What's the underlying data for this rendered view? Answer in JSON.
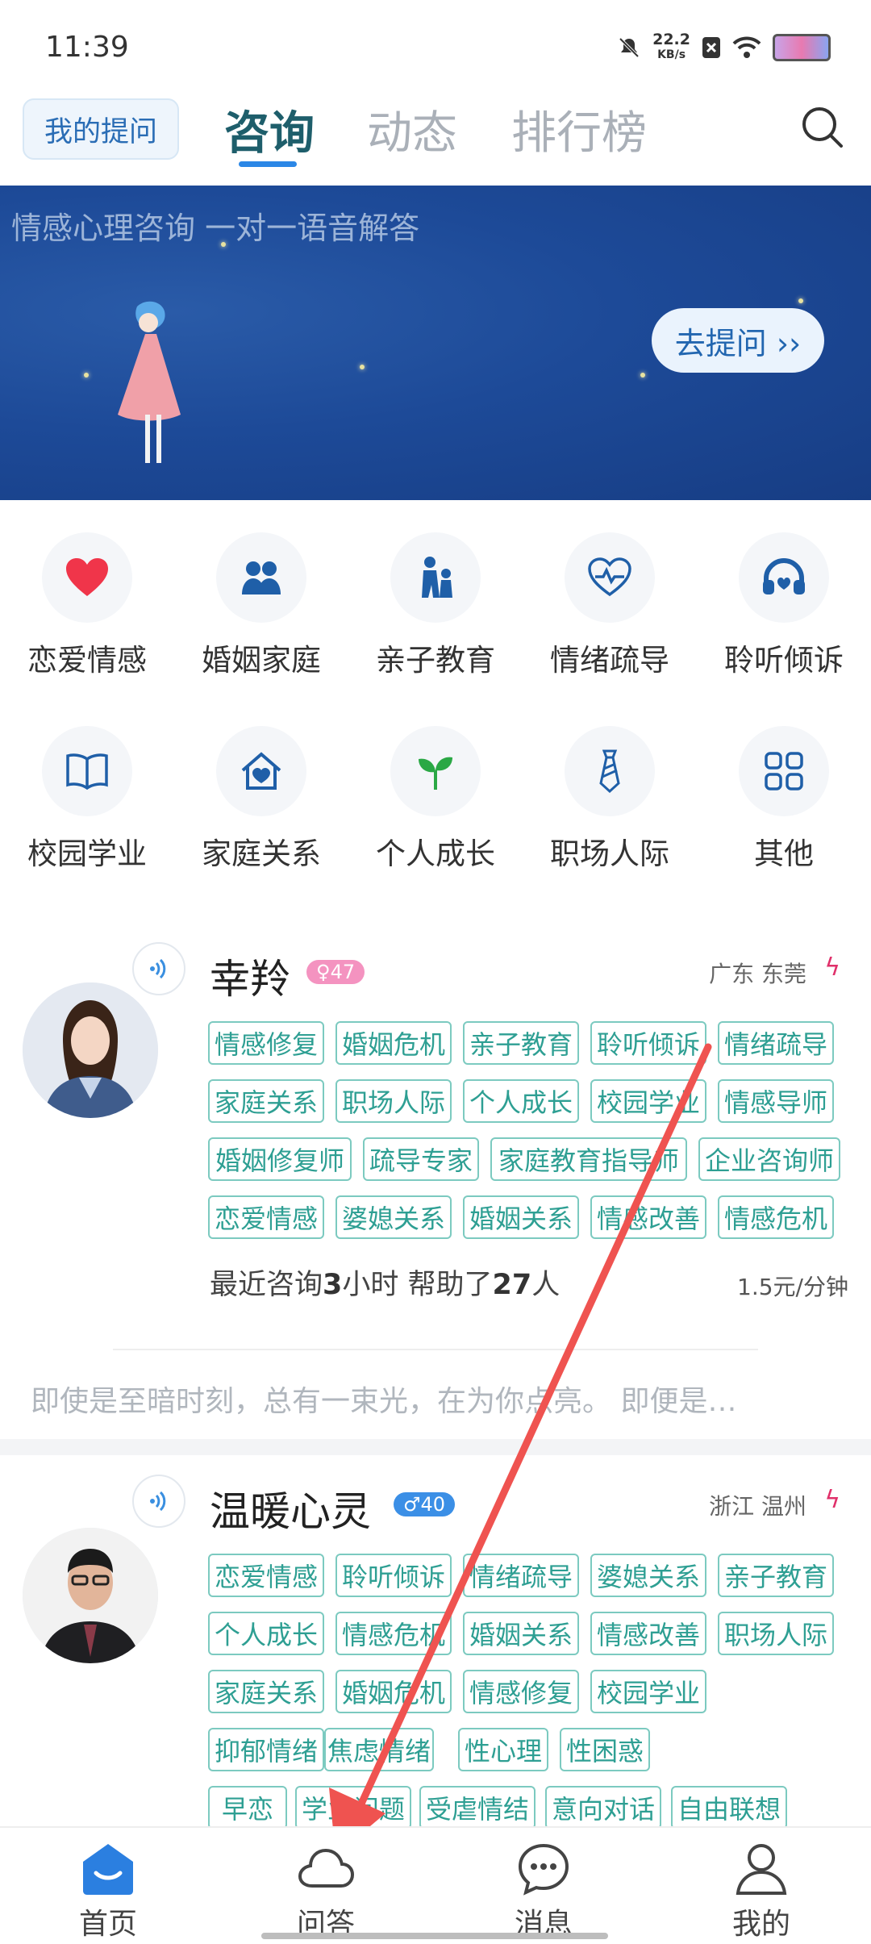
{
  "status_bar": {
    "time": "11:39",
    "net_speed_value": "22.2",
    "net_speed_unit": "KB/s"
  },
  "header": {
    "my_questions": "我的提问",
    "tabs": [
      {
        "label": "咨询",
        "active": true
      },
      {
        "label": "动态",
        "active": false
      },
      {
        "label": "排行榜",
        "active": false
      }
    ]
  },
  "banner": {
    "title": "情感心理咨询 一对一语音解答",
    "button": "去提问 ››"
  },
  "categories": [
    {
      "label": "恋爱情感",
      "icon": "heart-icon"
    },
    {
      "label": "婚姻家庭",
      "icon": "couple-icon"
    },
    {
      "label": "亲子教育",
      "icon": "parent-child-icon"
    },
    {
      "label": "情绪疏导",
      "icon": "heartbeat-icon"
    },
    {
      "label": "聆听倾诉",
      "icon": "headphones-icon"
    },
    {
      "label": "校园学业",
      "icon": "book-icon"
    },
    {
      "label": "家庭关系",
      "icon": "home-heart-icon"
    },
    {
      "label": "个人成长",
      "icon": "sprout-icon"
    },
    {
      "label": "职场人际",
      "icon": "tie-icon"
    },
    {
      "label": "其他",
      "icon": "grid-icon"
    }
  ],
  "consultants": [
    {
      "name": "幸羚",
      "badge": "♀47",
      "location": "广东 东莞",
      "tags": [
        "情感修复",
        "婚姻危机",
        "亲子教育",
        "聆听倾诉",
        "情绪疏导",
        "家庭关系",
        "职场人际",
        "个人成长",
        "校园学业",
        "情感导师",
        "婚姻修复师",
        "疏导专家",
        "家庭教育指导师",
        "企业咨询师",
        "恋爱情感",
        "婆媳关系",
        "婚姻关系",
        "情感改善",
        "情感危机"
      ],
      "stats_prefix": "最近咨询",
      "stats_hours": "3",
      "stats_mid": "小时 帮助了",
      "stats_people": "27",
      "stats_suffix": "人",
      "price": "1.5元/分钟",
      "motto": "即使是至暗时刻，总有一束光，在为你点亮。 即便是…"
    },
    {
      "name": "温暖心灵",
      "badge": "♂40",
      "location": "浙江 温州",
      "tags": [
        "恋爱情感",
        "聆听倾诉",
        "情绪疏导",
        "婆媳关系",
        "亲子教育",
        "个人成长",
        "情感危机",
        "婚姻关系",
        "情感改善",
        "职场人际",
        "家庭关系",
        "婚姻危机",
        "情感修复",
        "校园学业",
        "抑郁情绪",
        "焦虑情绪",
        "性心理",
        "性困惑",
        "早恋",
        "学业问题",
        "受虐情结",
        "意向对话",
        "自由联想"
      ]
    }
  ],
  "bottom_nav": [
    {
      "label": "首页",
      "icon": "home-icon",
      "active": true
    },
    {
      "label": "问答",
      "icon": "cloud-icon",
      "active": false
    },
    {
      "label": "消息",
      "icon": "message-icon",
      "active": false
    },
    {
      "label": "我的",
      "icon": "person-icon",
      "active": false
    }
  ],
  "colors": {
    "accent": "#2b87e6",
    "tag_border": "#7ccac0",
    "tag_text": "#2e9f93",
    "banner_bg": "#1d4a98",
    "annotation_arrow": "#ef5350"
  }
}
